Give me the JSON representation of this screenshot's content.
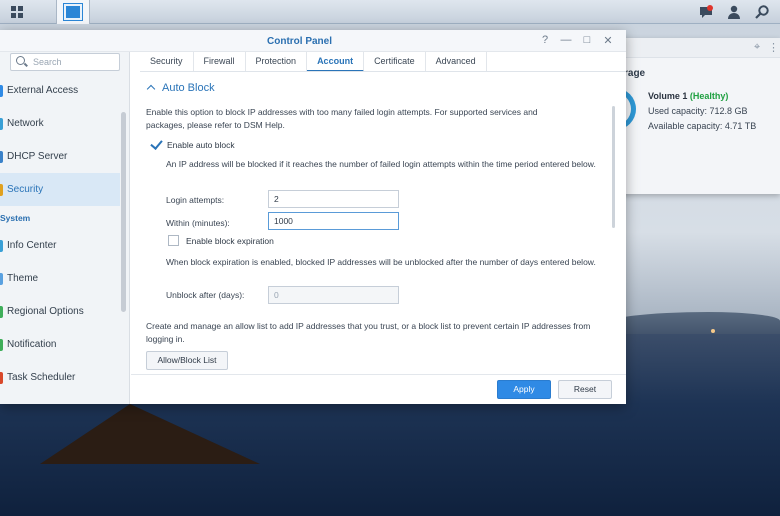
{
  "control_panel": {
    "title": "Control Panel",
    "controls": {
      "help": "?",
      "minimize": "—",
      "maximize": "□",
      "close": "✕"
    },
    "search_placeholder": "Search",
    "sidebar": {
      "items": [
        {
          "label": "External Access",
          "color": "#2f8ae5"
        },
        {
          "label": "Network",
          "color": "#3aa0d6"
        },
        {
          "label": "DHCP Server",
          "color": "#3b82c9"
        },
        {
          "label": "Security",
          "color": "#e0a11f"
        },
        {
          "label": "Info Center",
          "color": "#3aa0d6"
        },
        {
          "label": "Theme",
          "color": "#5aa1e0"
        },
        {
          "label": "Regional Options",
          "color": "#3fae5a"
        },
        {
          "label": "Notification",
          "color": "#3fae5a"
        },
        {
          "label": "Task Scheduler",
          "color": "#d9482b"
        }
      ],
      "section_system": "System"
    },
    "tabs": [
      "Security",
      "Firewall",
      "Protection",
      "Account",
      "Certificate",
      "Advanced"
    ],
    "active_tab": "Account",
    "auto_block": {
      "heading": "Auto Block",
      "intro": "Enable this option to block IP addresses with too many failed login attempts. For supported services and packages, please refer to DSM Help.",
      "enable_label": "Enable auto block",
      "enable_checked": true,
      "explain": "An IP address will be blocked if it reaches the number of failed login attempts within the time period entered below.",
      "login_attempts_label": "Login attempts:",
      "login_attempts_value": "2",
      "within_label": "Within (minutes):",
      "within_value": "1000",
      "expiration_label": "Enable block expiration",
      "expiration_checked": false,
      "expiration_explain": "When block expiration is enabled, blocked IP addresses will be unblocked after the number of days entered below.",
      "unblock_label": "Unblock after (days):",
      "unblock_value": "0",
      "allow_list_text": "Create and manage an allow list to add IP addresses that you trust, or a block list to prevent certain IP addresses from logging in.",
      "allow_block_button": "Allow/Block List"
    },
    "apply_button": "Apply",
    "reset_button": "Reset"
  },
  "storage_widget": {
    "title": "rage",
    "volume_name": "Volume 1",
    "volume_status": "(Healthy)",
    "used_capacity": "Used capacity: 712.8 GB",
    "available_capacity": "Available capacity: 4.71 TB"
  },
  "colors": {
    "accent": "#2a74b8",
    "primary_button": "#2f8ae5",
    "healthy": "#1fa041"
  }
}
